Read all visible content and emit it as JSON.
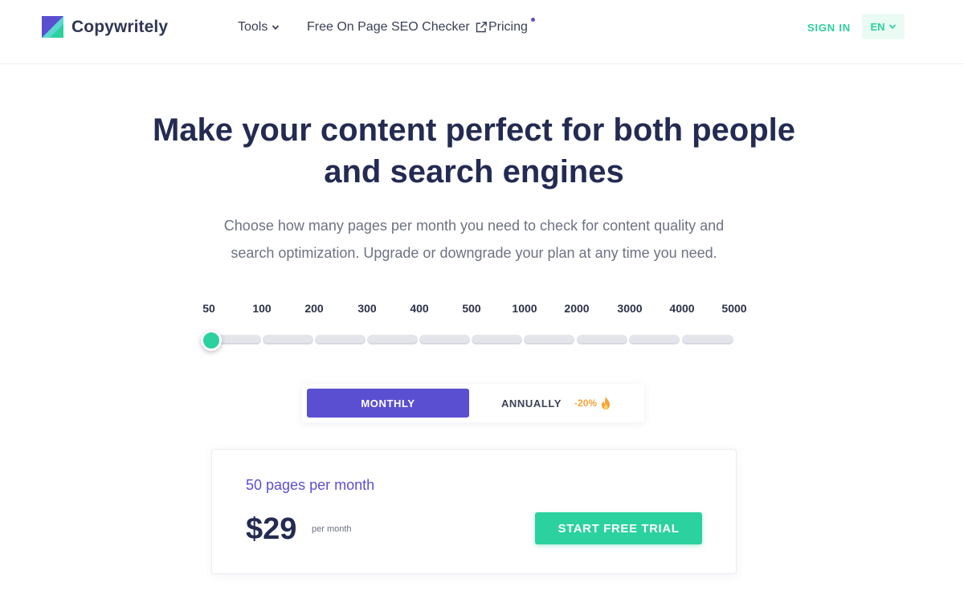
{
  "brand": {
    "name": "Copywritely",
    "accent": "#5b4fd1",
    "green": "#2bd19e"
  },
  "nav": {
    "tools_label": "Tools",
    "seo_checker_label": "Free On Page SEO Checker",
    "pricing_label": "Pricing",
    "signin_label": "SIGN IN",
    "language": "EN"
  },
  "hero": {
    "headline_line1": "Make your content perfect for both people",
    "headline_line2": "and search engines",
    "subtitle_line1": "Choose how many pages per month you need to check for content quality and",
    "subtitle_line2": "search optimization. Upgrade or downgrade your plan at any time you need."
  },
  "slider": {
    "ticks": [
      "50",
      "100",
      "200",
      "300",
      "400",
      "500",
      "1000",
      "2000",
      "3000",
      "4000",
      "5000"
    ],
    "selected_index": 0
  },
  "billing": {
    "monthly_label": "MONTHLY",
    "annually_label": "ANNUALLY",
    "discount": "-20%",
    "selected": "monthly"
  },
  "plan": {
    "pages_text": "50 pages per month",
    "price": "$29",
    "period": "per month",
    "cta_label": "START FREE TRIAL"
  }
}
